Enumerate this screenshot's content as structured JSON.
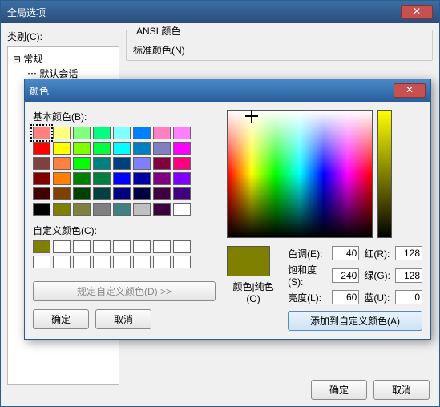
{
  "parent": {
    "title": "全局选项",
    "category_label": "类别(C):",
    "tree": {
      "root": "常规",
      "child": "默认会话"
    },
    "ansi_group": "ANSI 颜色",
    "std_colors": "标准颜色(N)",
    "ok": "确定",
    "cancel": "取消"
  },
  "dlg": {
    "title": "颜色",
    "basic_label": "基本颜色(B):",
    "custom_label": "自定义颜色(C):",
    "define": "规定自定义颜色(D) >>",
    "ok": "确定",
    "cancel": "取消",
    "solid_label": "颜色|纯色(O)",
    "hue_l": "色调(E):",
    "sat_l": "饱和度(S):",
    "lum_l": "亮度(L):",
    "red_l": "红(R):",
    "green_l": "绿(G):",
    "blue_l": "蓝(U):",
    "hue": "40",
    "sat": "240",
    "lum": "60",
    "red": "128",
    "green": "128",
    "blue": "0",
    "add": "添加到自定义颜色(A)",
    "basic_colors": [
      "#ff8080",
      "#ffff80",
      "#80ff80",
      "#00ff80",
      "#80ffff",
      "#0080ff",
      "#ff80c0",
      "#ff80ff",
      "#ff0000",
      "#ffff00",
      "#80ff00",
      "#00ff40",
      "#00ffff",
      "#0080c0",
      "#8080c0",
      "#ff00ff",
      "#804040",
      "#ff8040",
      "#00ff00",
      "#008080",
      "#004080",
      "#8080ff",
      "#800040",
      "#ff0080",
      "#800000",
      "#ff8000",
      "#008000",
      "#008040",
      "#0000ff",
      "#0000a0",
      "#800080",
      "#8000ff",
      "#400000",
      "#804000",
      "#004000",
      "#004040",
      "#000080",
      "#000040",
      "#400040",
      "#400080",
      "#000000",
      "#808000",
      "#808040",
      "#808080",
      "#408080",
      "#c0c0c0",
      "#400040",
      "#ffffff"
    ],
    "custom_sel": "#808000"
  }
}
